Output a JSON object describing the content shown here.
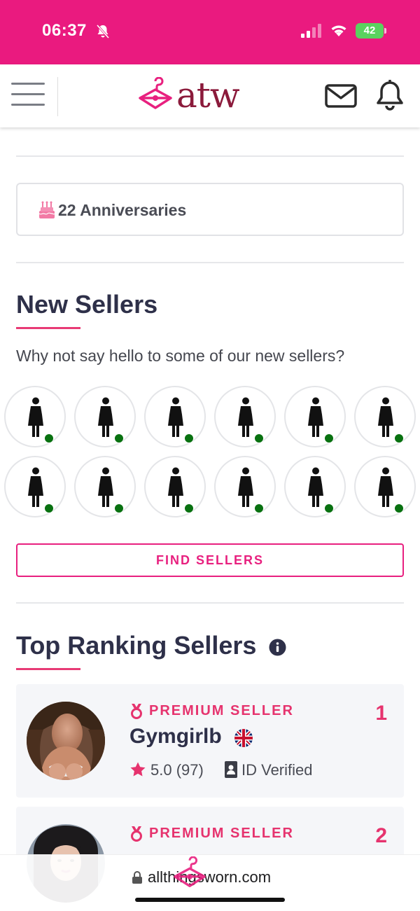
{
  "status_bar": {
    "time": "06:37",
    "battery": "42",
    "background_color": "#ea1a7f"
  },
  "header": {
    "logo_text": "atw",
    "brand_color": "#8b1a3b",
    "icons": [
      "menu-icon",
      "hanger-logo-icon",
      "mail-icon",
      "bell-icon"
    ]
  },
  "anniversaries": {
    "label": "22 Anniversaries",
    "icon": "cake-icon"
  },
  "new_sellers": {
    "title": "New Sellers",
    "intro": "Why not say hello to some of our new sellers?",
    "avatar_count": 12,
    "online_color": "#087110",
    "find_button_label": "FIND SELLERS"
  },
  "top_ranking": {
    "title": "Top Ranking Sellers",
    "accent_color": "#e6336e",
    "sellers": [
      {
        "rank": "1",
        "badge": "PREMIUM SELLER",
        "name": "Gymgirlb",
        "country": "uk-flag-icon",
        "rating": "5.0 (97)",
        "verified": "ID Verified"
      },
      {
        "rank": "2",
        "badge": "PREMIUM SELLER",
        "name": "",
        "rating": "",
        "verified": ""
      }
    ]
  },
  "browser": {
    "url": "allthingsworn.com"
  }
}
